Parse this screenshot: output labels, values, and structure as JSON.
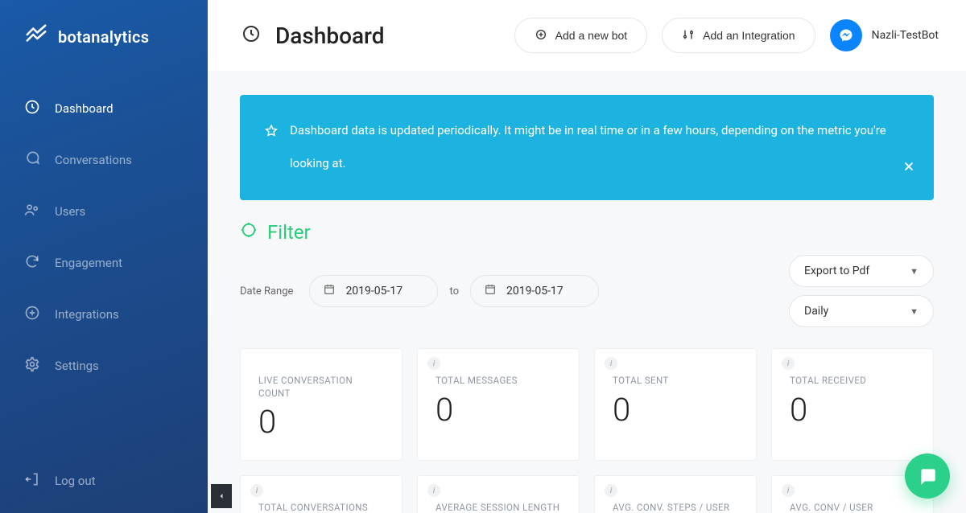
{
  "brand": {
    "name": "botanalytics"
  },
  "sidebar": {
    "items": [
      {
        "label": "Dashboard"
      },
      {
        "label": "Conversations"
      },
      {
        "label": "Users"
      },
      {
        "label": "Engagement"
      },
      {
        "label": "Integrations"
      },
      {
        "label": "Settings"
      }
    ],
    "logout_label": "Log out"
  },
  "header": {
    "title": "Dashboard",
    "add_bot_label": "Add a new bot",
    "add_integration_label": "Add an Integration",
    "bot_name": "Nazli-TestBot"
  },
  "notice": {
    "text": "Dashboard data is updated periodically. It might be in real time or in a few hours, depending on the metric you're looking at."
  },
  "filter": {
    "title": "Filter",
    "date_range_label": "Date Range",
    "date_from": "2019-05-17",
    "to_label": "to",
    "date_to": "2019-05-17",
    "export_label": "Export to Pdf",
    "granularity_label": "Daily"
  },
  "cards_row1": [
    {
      "title": "LIVE CONVERSATION COUNT",
      "value": "0"
    },
    {
      "title": "TOTAL MESSAGES",
      "value": "0"
    },
    {
      "title": "TOTAL SENT",
      "value": "0"
    },
    {
      "title": "TOTAL RECEIVED",
      "value": "0"
    }
  ],
  "cards_row2": [
    {
      "title": "TOTAL CONVERSATIONS"
    },
    {
      "title": "AVERAGE SESSION LENGTH"
    },
    {
      "title": "AVG. CONV. STEPS / USER"
    },
    {
      "title": "AVG. CONV / USER"
    }
  ]
}
